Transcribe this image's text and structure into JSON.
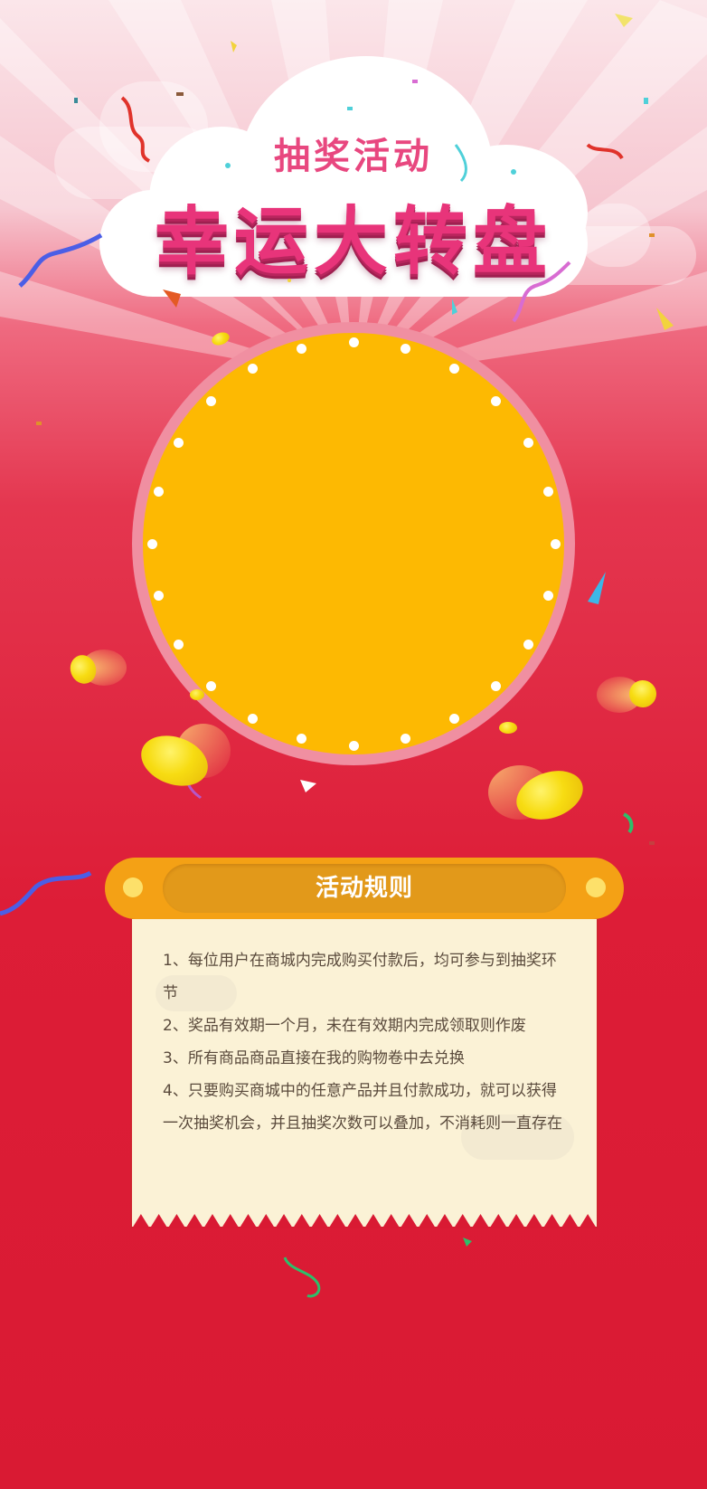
{
  "banner": {
    "subtitle": "抽奖活动",
    "title": "幸运大转盘"
  },
  "wheel": {
    "color": "#fdb902",
    "ring_color": "#f08fa1",
    "bulb_count": 24
  },
  "rules": {
    "heading": "活动规则",
    "items": [
      "1、每位用户在商城内完成购买付款后，均可参与到抽奖环节",
      "2、奖品有效期一个月，未在有效期内完成领取则作废",
      "3、所有商品商品直接在我的购物卷中去兑换",
      "4、只要购买商城中的任意产品并且付款成功，就可以获得一次抽奖机会，并且抽奖次数可以叠加，不消耗则一直存在"
    ]
  },
  "colors": {
    "background_top": "#fbe6ea",
    "background_bottom": "#d91a33",
    "title_pink": "#e8347a",
    "header_orange": "#f4a115",
    "paper": "#fbf2d6"
  }
}
